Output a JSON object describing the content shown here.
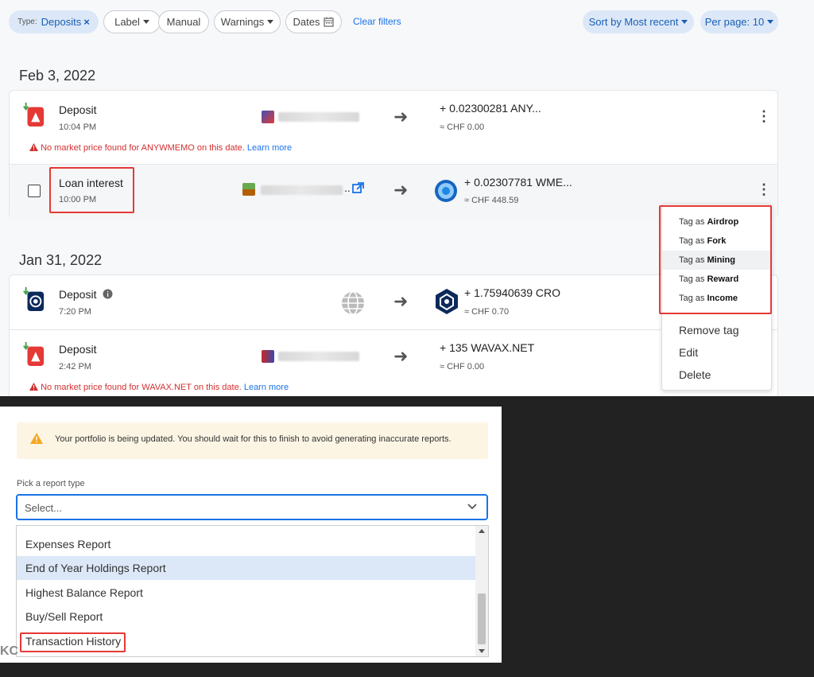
{
  "filters": {
    "type_prefix": "Type:",
    "type_value": "Deposits",
    "type_remove": "×",
    "label": "Label",
    "manual": "Manual",
    "warnings": "Warnings",
    "dates": "Dates",
    "clear": "Clear filters",
    "sort": "Sort by Most recent",
    "per_page": "Per page: 10"
  },
  "groups": [
    {
      "date": "Feb 3, 2022",
      "transactions": [
        {
          "type": "Deposit",
          "time": "10:04 PM",
          "amount": "+ 0.02300281 ANY...",
          "fiat": "≈ CHF 0.00",
          "warning": "No market price found for ANYWMEMO on this date.",
          "learn_more": "Learn more"
        },
        {
          "type": "Loan interest",
          "time": "10:00 PM",
          "amount": "+ 0.02307781 WME...",
          "fiat": "≈ CHF 448.59",
          "wallet_suffix": ".."
        }
      ]
    },
    {
      "date": "Jan 31, 2022",
      "transactions": [
        {
          "type": "Deposit",
          "time": "7:20 PM",
          "amount": "+ 1.75940639 CRO",
          "fiat": "≈ CHF 0.70"
        },
        {
          "type": "Deposit",
          "time": "2:42 PM",
          "amount": "+ 135 WAVAX.NET",
          "fiat": "≈ CHF 0.00",
          "warning": "No market price found for WAVAX.NET on this date.",
          "learn_more": "Learn more"
        }
      ]
    }
  ],
  "context_menu": {
    "tag_prefix": "Tag as",
    "tags": [
      "Airdrop",
      "Fork",
      "Mining",
      "Reward",
      "Income"
    ],
    "actions": [
      "Remove tag",
      "Edit",
      "Delete"
    ]
  },
  "report_dialog": {
    "notice": "Your portfolio is being updated. You should wait for this to finish to avoid generating inaccurate reports.",
    "label": "Pick a report type",
    "placeholder": "Select...",
    "options": [
      "Expenses Report",
      "End of Year Holdings Report",
      "Highest Balance Report",
      "Buy/Sell Report",
      "Transaction History"
    ],
    "background_fragment": "KC"
  },
  "colors": {
    "accent": "#1a73e8",
    "warning": "#d32f2f",
    "highlight_box": "#e53935",
    "deposit_red": "#e53935",
    "deposit_arrow": "#43a047"
  },
  "icons": [
    "deposit-icon",
    "cro-icon",
    "wmemo-icon",
    "globe-icon",
    "external-link-icon",
    "info-icon",
    "calendar-icon",
    "warning-icon",
    "chevron-down-icon",
    "kebab-menu-icon"
  ]
}
